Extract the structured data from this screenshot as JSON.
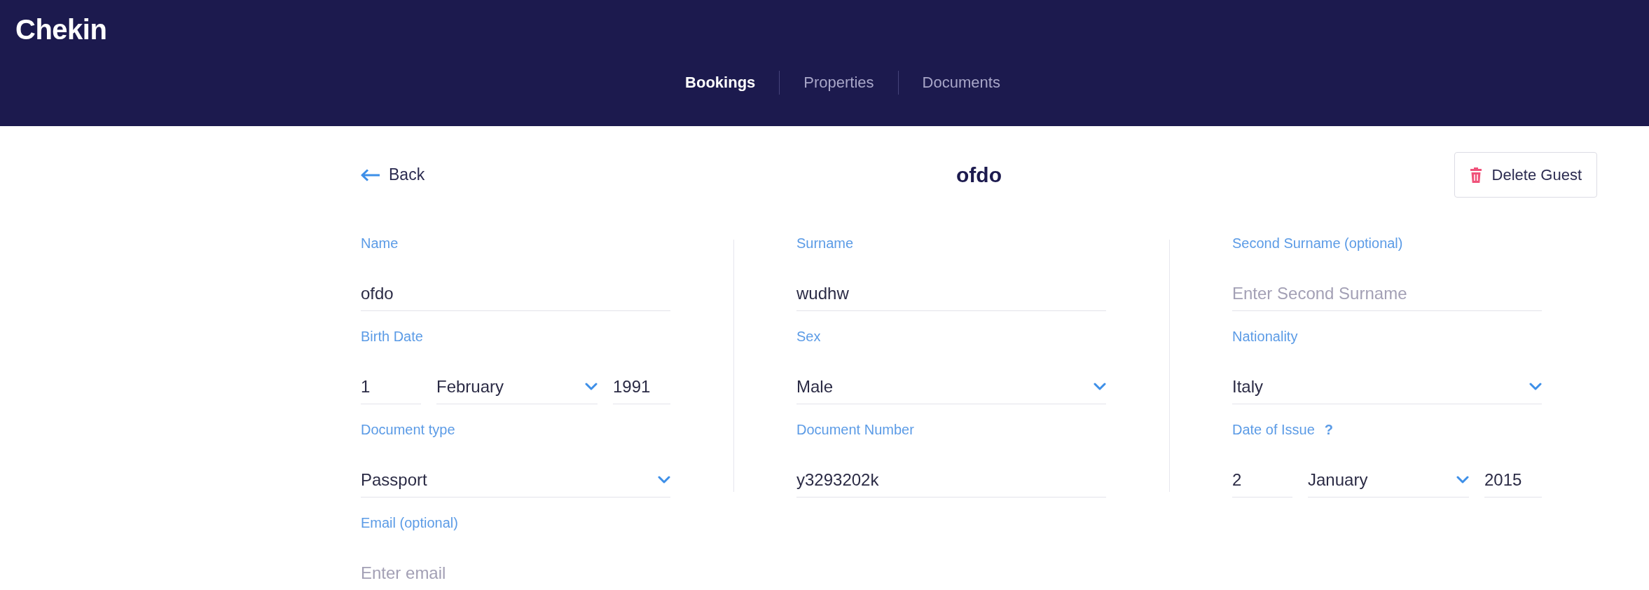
{
  "header": {
    "logo": "Chekin",
    "nav": [
      {
        "label": "Bookings",
        "selected": true
      },
      {
        "label": "Properties",
        "selected": false
      },
      {
        "label": "Documents",
        "selected": false
      }
    ]
  },
  "toolbar": {
    "back": "Back",
    "title": "ofdo",
    "delete_button": "Delete Guest"
  },
  "form": {
    "rows": [
      [
        {
          "kind": "text",
          "label": "Name",
          "value": "ofdo"
        },
        {
          "kind": "text",
          "label": "Surname",
          "value": "wudhw"
        },
        {
          "kind": "text",
          "label": "Second Surname (optional)",
          "placeholder": "Enter Second Surname"
        }
      ],
      [
        {
          "kind": "date",
          "label": "Birth Date",
          "day": "1",
          "month": "February",
          "year": "1991"
        },
        {
          "kind": "select",
          "label": "Sex",
          "value": "Male"
        },
        {
          "kind": "select",
          "label": "Nationality",
          "value": "Italy"
        }
      ],
      [
        {
          "kind": "select",
          "label": "Document type",
          "value": "Passport"
        },
        {
          "kind": "text",
          "label": "Document Number",
          "value": "y3293202k"
        },
        {
          "kind": "date",
          "label": "Date of Issue",
          "help": "?",
          "day": "2",
          "month": "January",
          "year": "2015"
        }
      ],
      [
        {
          "kind": "text",
          "label": "Email (optional)",
          "placeholder": "Enter email"
        }
      ]
    ]
  }
}
